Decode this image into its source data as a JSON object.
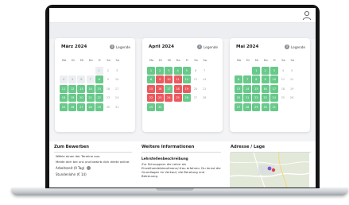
{
  "calendars": [
    {
      "title": "März 2024",
      "legend": "Legende",
      "weekdays": [
        "Mo",
        "Di",
        "Mi",
        "Do",
        "Fr",
        "Sa",
        "So"
      ],
      "days": [
        {
          "d": "",
          "t": "e"
        },
        {
          "d": "",
          "t": "e"
        },
        {
          "d": "",
          "t": "e"
        },
        {
          "d": "",
          "t": "e"
        },
        {
          "d": "1",
          "t": "s"
        },
        {
          "d": "2",
          "t": "n"
        },
        {
          "d": "3",
          "t": "n"
        },
        {
          "d": "4",
          "t": "s"
        },
        {
          "d": "5",
          "t": "s"
        },
        {
          "d": "6",
          "t": "s"
        },
        {
          "d": "7",
          "t": "s"
        },
        {
          "d": "8",
          "t": "g"
        },
        {
          "d": "9",
          "t": "n"
        },
        {
          "d": "10",
          "t": "n"
        },
        {
          "d": "11",
          "t": "g"
        },
        {
          "d": "12",
          "t": "g"
        },
        {
          "d": "13",
          "t": "g"
        },
        {
          "d": "14",
          "t": "g"
        },
        {
          "d": "15",
          "t": "g"
        },
        {
          "d": "16",
          "t": "n"
        },
        {
          "d": "17",
          "t": "n"
        },
        {
          "d": "18",
          "t": "g"
        },
        {
          "d": "19",
          "t": "g"
        },
        {
          "d": "20",
          "t": "g"
        },
        {
          "d": "21",
          "t": "g"
        },
        {
          "d": "22",
          "t": "g"
        },
        {
          "d": "23",
          "t": "n"
        },
        {
          "d": "24",
          "t": "n"
        },
        {
          "d": "25",
          "t": "g"
        },
        {
          "d": "26",
          "t": "g"
        },
        {
          "d": "27",
          "t": "g"
        },
        {
          "d": "28",
          "t": "g"
        },
        {
          "d": "29",
          "t": "g"
        },
        {
          "d": "30",
          "t": "n"
        },
        {
          "d": "31",
          "t": "n"
        }
      ]
    },
    {
      "title": "April 2024",
      "legend": "Legende",
      "weekdays": [
        "Mo",
        "Di",
        "Mi",
        "Do",
        "Fr",
        "Sa",
        "So"
      ],
      "days": [
        {
          "d": "1",
          "t": "g"
        },
        {
          "d": "2",
          "t": "g"
        },
        {
          "d": "3",
          "t": "g"
        },
        {
          "d": "4",
          "t": "g"
        },
        {
          "d": "5",
          "t": "g"
        },
        {
          "d": "6",
          "t": "n"
        },
        {
          "d": "7",
          "t": "n"
        },
        {
          "d": "8",
          "t": "g"
        },
        {
          "d": "9",
          "t": "r"
        },
        {
          "d": "10",
          "t": "r"
        },
        {
          "d": "11",
          "t": "r"
        },
        {
          "d": "12",
          "t": "g"
        },
        {
          "d": "13",
          "t": "n"
        },
        {
          "d": "14",
          "t": "n"
        },
        {
          "d": "15",
          "t": "r"
        },
        {
          "d": "16",
          "t": "r"
        },
        {
          "d": "17",
          "t": "g"
        },
        {
          "d": "18",
          "t": "r"
        },
        {
          "d": "19",
          "t": "r"
        },
        {
          "d": "20",
          "t": "n"
        },
        {
          "d": "21",
          "t": "n"
        },
        {
          "d": "22",
          "t": "r"
        },
        {
          "d": "23",
          "t": "r"
        },
        {
          "d": "24",
          "t": "r"
        },
        {
          "d": "25",
          "t": "r"
        },
        {
          "d": "26",
          "t": "g"
        },
        {
          "d": "27",
          "t": "n"
        },
        {
          "d": "28",
          "t": "n"
        },
        {
          "d": "29",
          "t": "g"
        },
        {
          "d": "30",
          "t": "g"
        },
        {
          "d": "",
          "t": "e"
        },
        {
          "d": "",
          "t": "e"
        },
        {
          "d": "",
          "t": "e"
        },
        {
          "d": "",
          "t": "e"
        },
        {
          "d": "",
          "t": "e"
        }
      ]
    },
    {
      "title": "Mai 2024",
      "legend": "Legende",
      "weekdays": [
        "Mo",
        "Di",
        "Mi",
        "Do",
        "Fr",
        "Sa",
        "So"
      ],
      "days": [
        {
          "d": "",
          "t": "e"
        },
        {
          "d": "",
          "t": "e"
        },
        {
          "d": "1",
          "t": "g"
        },
        {
          "d": "2",
          "t": "g"
        },
        {
          "d": "3",
          "t": "g"
        },
        {
          "d": "4",
          "t": "n"
        },
        {
          "d": "5",
          "t": "n"
        },
        {
          "d": "6",
          "t": "g"
        },
        {
          "d": "7",
          "t": "g"
        },
        {
          "d": "8",
          "t": "g"
        },
        {
          "d": "9",
          "t": "g"
        },
        {
          "d": "10",
          "t": "g"
        },
        {
          "d": "11",
          "t": "n"
        },
        {
          "d": "12",
          "t": "n"
        },
        {
          "d": "13",
          "t": "g"
        },
        {
          "d": "14",
          "t": "g"
        },
        {
          "d": "15",
          "t": "g"
        },
        {
          "d": "16",
          "t": "g"
        },
        {
          "d": "17",
          "t": "g"
        },
        {
          "d": "18",
          "t": "n"
        },
        {
          "d": "19",
          "t": "n"
        },
        {
          "d": "20",
          "t": "g"
        },
        {
          "d": "21",
          "t": "g"
        },
        {
          "d": "22",
          "t": "g"
        },
        {
          "d": "23",
          "t": "g"
        },
        {
          "d": "24",
          "t": "g"
        },
        {
          "d": "25",
          "t": "n"
        },
        {
          "d": "26",
          "t": "n"
        },
        {
          "d": "27",
          "t": "g"
        },
        {
          "d": "28",
          "t": "g"
        },
        {
          "d": "29",
          "t": "g"
        },
        {
          "d": "30",
          "t": "g"
        },
        {
          "d": "31",
          "t": "g"
        },
        {
          "d": "",
          "t": "e"
        },
        {
          "d": "",
          "t": "e"
        }
      ]
    }
  ],
  "apply": {
    "title": "Zum Bewerben",
    "bullets": [
      "Wähle einen der Termine aus.",
      "Melde dich bei uns und bewirb dich direkt online."
    ],
    "hours_label": "Arbeitszeit (9 Tag)",
    "extra_label": "Stundenlohn (€ 14)"
  },
  "info": {
    "title": "Weitere Informationen",
    "subtitle": "Lehrstellenbeschreibung",
    "paragraph": "Zur Schnuppern die Lehre als Einzelhandelskaufmann/-frau erfahren. Du lernst die Grundlagen im Verkauf, die Beratung und Betreuung."
  },
  "address": {
    "title": "Adresse / Lage"
  },
  "colors": {
    "available": "#68c98a",
    "booked": "#ea5a5f"
  }
}
